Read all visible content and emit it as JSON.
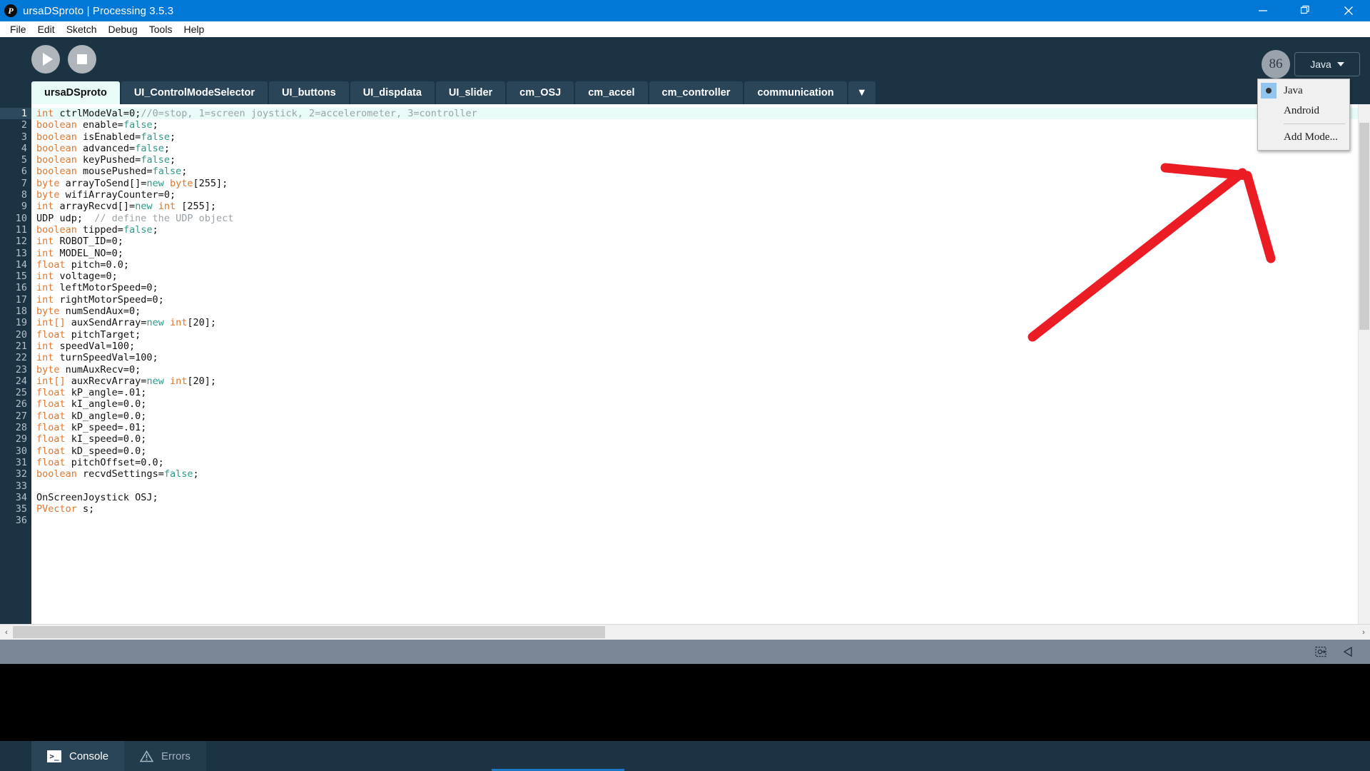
{
  "window": {
    "title": "ursaDSproto | Processing 3.5.3",
    "logo_glyph": "P",
    "minimize_label": "Minimize",
    "maximize_label": "Maximize",
    "close_label": "Close",
    "accent_color": "#0078d7"
  },
  "menubar": {
    "items": [
      "File",
      "Edit",
      "Sketch",
      "Debug",
      "Tools",
      "Help"
    ]
  },
  "toolbar": {
    "run_label": "Run",
    "stop_label": "Stop",
    "mode_button_label": "Java",
    "mode_circle_glyph": "86"
  },
  "mode_menu": {
    "open": true,
    "items": [
      {
        "label": "Java",
        "selected": true
      },
      {
        "label": "Android",
        "selected": false
      },
      {
        "label": "Add Mode...",
        "selected": false
      }
    ]
  },
  "tabs": {
    "items": [
      {
        "label": "ursaDSproto",
        "active": true
      },
      {
        "label": "UI_ControlModeSelector",
        "active": false
      },
      {
        "label": "UI_buttons",
        "active": false
      },
      {
        "label": "UI_dispdata",
        "active": false
      },
      {
        "label": "UI_slider",
        "active": false
      },
      {
        "label": "cm_OSJ",
        "active": false
      },
      {
        "label": "cm_accel",
        "active": false
      },
      {
        "label": "cm_controller",
        "active": false
      },
      {
        "label": "communication",
        "active": false
      }
    ],
    "overflow_label": "▼"
  },
  "editor": {
    "first_line": 1,
    "active_line": 1,
    "total_visible_lines": 36,
    "lines": [
      {
        "n": 1,
        "active": true,
        "tokens": [
          {
            "t": "kw",
            "s": "int"
          },
          {
            "t": "pln",
            "s": " ctrlModeVal="
          },
          {
            "t": "pln",
            "s": "0;"
          },
          {
            "t": "cmt",
            "s": "//0=stop, 1=screen joystick, 2=accelerometer, 3=controller"
          }
        ]
      },
      {
        "n": 2,
        "active": false,
        "tokens": [
          {
            "t": "kw",
            "s": "boolean"
          },
          {
            "t": "pln",
            "s": " enable="
          },
          {
            "t": "lit",
            "s": "false"
          },
          {
            "t": "pln",
            "s": ";"
          }
        ]
      },
      {
        "n": 3,
        "active": false,
        "tokens": [
          {
            "t": "kw",
            "s": "boolean"
          },
          {
            "t": "pln",
            "s": " isEnabled="
          },
          {
            "t": "lit",
            "s": "false"
          },
          {
            "t": "pln",
            "s": ";"
          }
        ]
      },
      {
        "n": 4,
        "active": false,
        "tokens": [
          {
            "t": "kw",
            "s": "boolean"
          },
          {
            "t": "pln",
            "s": " advanced="
          },
          {
            "t": "lit",
            "s": "false"
          },
          {
            "t": "pln",
            "s": ";"
          }
        ]
      },
      {
        "n": 5,
        "active": false,
        "tokens": [
          {
            "t": "kw",
            "s": "boolean"
          },
          {
            "t": "pln",
            "s": " keyPushed="
          },
          {
            "t": "lit",
            "s": "false"
          },
          {
            "t": "pln",
            "s": ";"
          }
        ]
      },
      {
        "n": 6,
        "active": false,
        "tokens": [
          {
            "t": "kw",
            "s": "boolean"
          },
          {
            "t": "pln",
            "s": " mousePushed="
          },
          {
            "t": "lit",
            "s": "false"
          },
          {
            "t": "pln",
            "s": ";"
          }
        ]
      },
      {
        "n": 7,
        "active": false,
        "tokens": [
          {
            "t": "kw",
            "s": "byte"
          },
          {
            "t": "pln",
            "s": " arrayToSend[]="
          },
          {
            "t": "lit",
            "s": "new"
          },
          {
            "t": "pln",
            "s": " "
          },
          {
            "t": "kw",
            "s": "byte"
          },
          {
            "t": "pln",
            "s": "[255];"
          }
        ]
      },
      {
        "n": 8,
        "active": false,
        "tokens": [
          {
            "t": "kw",
            "s": "byte"
          },
          {
            "t": "pln",
            "s": " wifiArrayCounter=0;"
          }
        ]
      },
      {
        "n": 9,
        "active": false,
        "tokens": [
          {
            "t": "kw",
            "s": "int"
          },
          {
            "t": "pln",
            "s": " arrayRecvd[]="
          },
          {
            "t": "lit",
            "s": "new"
          },
          {
            "t": "pln",
            "s": " "
          },
          {
            "t": "kw",
            "s": "int"
          },
          {
            "t": "pln",
            "s": " [255];"
          }
        ]
      },
      {
        "n": 10,
        "active": false,
        "tokens": [
          {
            "t": "pln",
            "s": "UDP udp;  "
          },
          {
            "t": "cmt",
            "s": "// define the UDP object"
          }
        ]
      },
      {
        "n": 11,
        "active": false,
        "tokens": [
          {
            "t": "kw",
            "s": "boolean"
          },
          {
            "t": "pln",
            "s": " tipped="
          },
          {
            "t": "lit",
            "s": "false"
          },
          {
            "t": "pln",
            "s": ";"
          }
        ]
      },
      {
        "n": 12,
        "active": false,
        "tokens": [
          {
            "t": "kw",
            "s": "int"
          },
          {
            "t": "pln",
            "s": " ROBOT_ID=0;"
          }
        ]
      },
      {
        "n": 13,
        "active": false,
        "tokens": [
          {
            "t": "kw",
            "s": "int"
          },
          {
            "t": "pln",
            "s": " MODEL_NO=0;"
          }
        ]
      },
      {
        "n": 14,
        "active": false,
        "tokens": [
          {
            "t": "kw",
            "s": "float"
          },
          {
            "t": "pln",
            "s": " pitch=0.0;"
          }
        ]
      },
      {
        "n": 15,
        "active": false,
        "tokens": [
          {
            "t": "kw",
            "s": "int"
          },
          {
            "t": "pln",
            "s": " voltage=0;"
          }
        ]
      },
      {
        "n": 16,
        "active": false,
        "tokens": [
          {
            "t": "kw",
            "s": "int"
          },
          {
            "t": "pln",
            "s": " leftMotorSpeed=0;"
          }
        ]
      },
      {
        "n": 17,
        "active": false,
        "tokens": [
          {
            "t": "kw",
            "s": "int"
          },
          {
            "t": "pln",
            "s": " rightMotorSpeed=0;"
          }
        ]
      },
      {
        "n": 18,
        "active": false,
        "tokens": [
          {
            "t": "kw",
            "s": "byte"
          },
          {
            "t": "pln",
            "s": " numSendAux=0;"
          }
        ]
      },
      {
        "n": 19,
        "active": false,
        "tokens": [
          {
            "t": "kw",
            "s": "int[]"
          },
          {
            "t": "pln",
            "s": " auxSendArray="
          },
          {
            "t": "lit",
            "s": "new"
          },
          {
            "t": "pln",
            "s": " "
          },
          {
            "t": "kw",
            "s": "int"
          },
          {
            "t": "pln",
            "s": "[20];"
          }
        ]
      },
      {
        "n": 20,
        "active": false,
        "tokens": [
          {
            "t": "kw",
            "s": "float"
          },
          {
            "t": "pln",
            "s": " pitchTarget;"
          }
        ]
      },
      {
        "n": 21,
        "active": false,
        "tokens": [
          {
            "t": "kw",
            "s": "int"
          },
          {
            "t": "pln",
            "s": " speedVal=100;"
          }
        ]
      },
      {
        "n": 22,
        "active": false,
        "tokens": [
          {
            "t": "kw",
            "s": "int"
          },
          {
            "t": "pln",
            "s": " turnSpeedVal=100;"
          }
        ]
      },
      {
        "n": 23,
        "active": false,
        "tokens": [
          {
            "t": "kw",
            "s": "byte"
          },
          {
            "t": "pln",
            "s": " numAuxRecv=0;"
          }
        ]
      },
      {
        "n": 24,
        "active": false,
        "tokens": [
          {
            "t": "kw",
            "s": "int[]"
          },
          {
            "t": "pln",
            "s": " auxRecvArray="
          },
          {
            "t": "lit",
            "s": "new"
          },
          {
            "t": "pln",
            "s": " "
          },
          {
            "t": "kw",
            "s": "int"
          },
          {
            "t": "pln",
            "s": "[20];"
          }
        ]
      },
      {
        "n": 25,
        "active": false,
        "tokens": [
          {
            "t": "kw",
            "s": "float"
          },
          {
            "t": "pln",
            "s": " kP_angle=.01;"
          }
        ]
      },
      {
        "n": 26,
        "active": false,
        "tokens": [
          {
            "t": "kw",
            "s": "float"
          },
          {
            "t": "pln",
            "s": " kI_angle=0.0;"
          }
        ]
      },
      {
        "n": 27,
        "active": false,
        "tokens": [
          {
            "t": "kw",
            "s": "float"
          },
          {
            "t": "pln",
            "s": " kD_angle=0.0;"
          }
        ]
      },
      {
        "n": 28,
        "active": false,
        "tokens": [
          {
            "t": "kw",
            "s": "float"
          },
          {
            "t": "pln",
            "s": " kP_speed=.01;"
          }
        ]
      },
      {
        "n": 29,
        "active": false,
        "tokens": [
          {
            "t": "kw",
            "s": "float"
          },
          {
            "t": "pln",
            "s": " kI_speed=0.0;"
          }
        ]
      },
      {
        "n": 30,
        "active": false,
        "tokens": [
          {
            "t": "kw",
            "s": "float"
          },
          {
            "t": "pln",
            "s": " kD_speed=0.0;"
          }
        ]
      },
      {
        "n": 31,
        "active": false,
        "tokens": [
          {
            "t": "kw",
            "s": "float"
          },
          {
            "t": "pln",
            "s": " pitchOffset=0.0;"
          }
        ]
      },
      {
        "n": 32,
        "active": false,
        "tokens": [
          {
            "t": "kw",
            "s": "boolean"
          },
          {
            "t": "pln",
            "s": " recvdSettings="
          },
          {
            "t": "lit",
            "s": "false"
          },
          {
            "t": "pln",
            "s": ";"
          }
        ]
      },
      {
        "n": 33,
        "active": false,
        "tokens": []
      },
      {
        "n": 34,
        "active": false,
        "tokens": [
          {
            "t": "pln",
            "s": "OnScreenJoystick OSJ;"
          }
        ]
      },
      {
        "n": 35,
        "active": false,
        "tokens": [
          {
            "t": "kw",
            "s": "PVector"
          },
          {
            "t": "pln",
            "s": " s;"
          }
        ]
      },
      {
        "n": 36,
        "active": false,
        "tokens": []
      }
    ]
  },
  "console": {
    "tabs": [
      {
        "label": "Console",
        "icon": "terminal-icon",
        "selected": true
      },
      {
        "label": "Errors",
        "icon": "warning-icon",
        "selected": false
      }
    ]
  },
  "statusbar": {
    "icons": [
      "move-to-window-icon",
      "collapse-arrow-icon"
    ]
  },
  "annotation": {
    "color": "#ec1c24",
    "shape": "arrow",
    "stroke_width": 13
  },
  "scrollbars": {
    "horizontal_thumb_label": "horizontal-scroll-thumb",
    "vertical_thumb_label": "vertical-scroll-thumb",
    "left_arrow": "‹",
    "right_arrow": "›"
  }
}
